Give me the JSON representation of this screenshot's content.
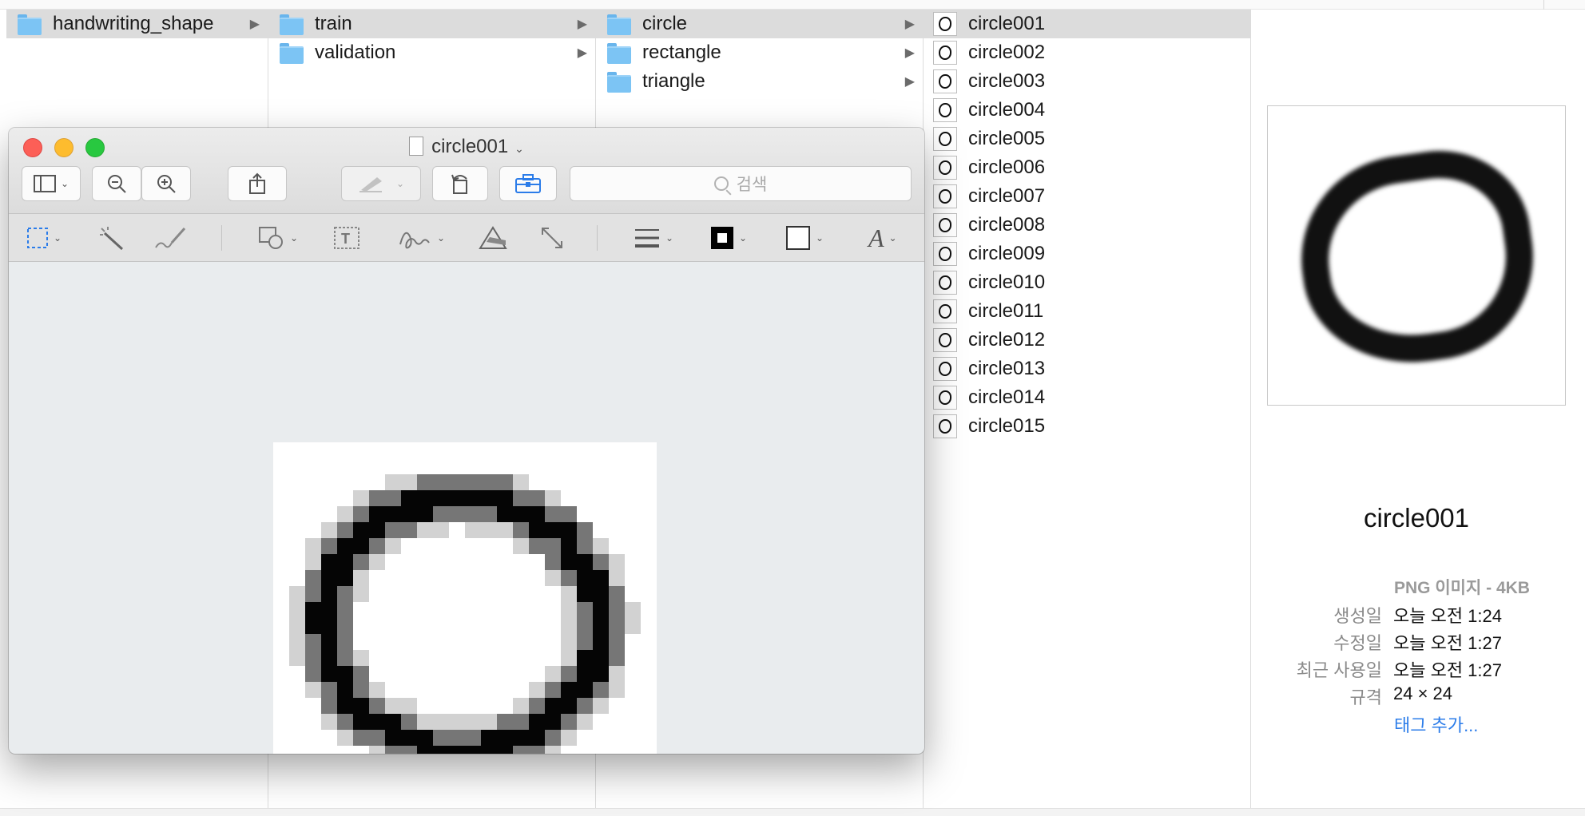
{
  "finder": {
    "col1": [
      {
        "label": "handwriting_shape",
        "selected": true
      }
    ],
    "col2": [
      {
        "label": "train",
        "selected": true
      },
      {
        "label": "validation",
        "selected": false
      }
    ],
    "col3": [
      {
        "label": "circle",
        "selected": true
      },
      {
        "label": "rectangle",
        "selected": false
      },
      {
        "label": "triangle",
        "selected": false
      }
    ],
    "files": [
      "circle001",
      "circle002",
      "circle003",
      "circle004",
      "circle005",
      "circle006",
      "circle007",
      "circle008",
      "circle009",
      "circle010",
      "circle011",
      "circle012",
      "circle013",
      "circle014",
      "circle015"
    ]
  },
  "preview_panel": {
    "name": "circle001",
    "type": "PNG 이미지 - 4KB",
    "meta": [
      {
        "key": "생성일",
        "value": "오늘 오전 1:24"
      },
      {
        "key": "수정일",
        "value": "오늘 오전 1:27"
      },
      {
        "key": "최근 사용일",
        "value": "오늘 오전 1:27"
      },
      {
        "key": "규격",
        "value": "24 × 24"
      }
    ],
    "tags_link": "태그 추가..."
  },
  "preview_window": {
    "title": "circle001",
    "search_placeholder": "검색"
  },
  "colors": {
    "folder": "#7cc4f4",
    "selection": "#dcdcdc",
    "link": "#2b7ce9",
    "close": "#fc5f57",
    "minimize": "#fdbc2e",
    "zoom": "#28c840"
  }
}
